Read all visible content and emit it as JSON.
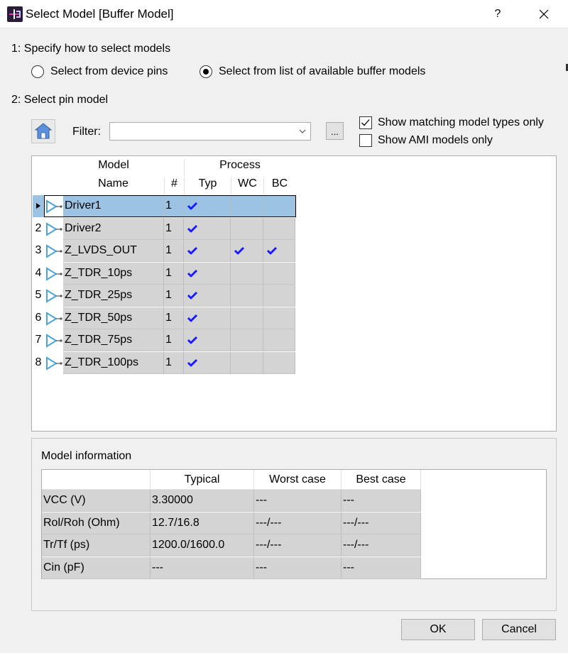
{
  "window": {
    "title": "Select Model [Buffer Model]",
    "help_label": "?"
  },
  "section1": {
    "label": "1: Specify how to select models",
    "option_device_pins": "Select from device pins",
    "option_buffer_list": "Select from list of available buffer models",
    "selected": "buffer_list"
  },
  "section2": {
    "label": "2: Select pin model",
    "filter_label": "Filter:",
    "filter_value": "",
    "browse_label": "...",
    "show_matching_label": "Show matching model types only",
    "show_matching_checked": true,
    "show_ami_label": "Show AMI models only",
    "show_ami_checked": false
  },
  "grid": {
    "group_headers": {
      "model": "Model",
      "process": "Process"
    },
    "columns": {
      "name": "Name",
      "count": "#",
      "typ": "Typ",
      "wc": "WC",
      "bc": "BC"
    },
    "rows": [
      {
        "num": "",
        "name": "Driver1",
        "count": "1",
        "typ": true,
        "wc": false,
        "bc": false,
        "selected": true
      },
      {
        "num": "2",
        "name": "Driver2",
        "count": "1",
        "typ": true,
        "wc": false,
        "bc": false
      },
      {
        "num": "3",
        "name": "Z_LVDS_OUT",
        "count": "1",
        "typ": true,
        "wc": true,
        "bc": true
      },
      {
        "num": "4",
        "name": "Z_TDR_10ps",
        "count": "1",
        "typ": true,
        "wc": false,
        "bc": false
      },
      {
        "num": "5",
        "name": "Z_TDR_25ps",
        "count": "1",
        "typ": true,
        "wc": false,
        "bc": false
      },
      {
        "num": "6",
        "name": "Z_TDR_50ps",
        "count": "1",
        "typ": true,
        "wc": false,
        "bc": false
      },
      {
        "num": "7",
        "name": "Z_TDR_75ps",
        "count": "1",
        "typ": true,
        "wc": false,
        "bc": false
      },
      {
        "num": "8",
        "name": "Z_TDR_100ps",
        "count": "1",
        "typ": true,
        "wc": false,
        "bc": false
      }
    ]
  },
  "model_info": {
    "title": "Model information",
    "columns": [
      "",
      "Typical",
      "Worst case",
      "Best case"
    ],
    "rows": [
      [
        "VCC (V)",
        "3.30000",
        "---",
        "---"
      ],
      [
        "Rol/Roh (Ohm)",
        "12.7/16.8",
        "---/---",
        "---/---"
      ],
      [
        "Tr/Tf (ps)",
        "1200.0/1600.0",
        "---/---",
        "---/---"
      ],
      [
        "Cin (pF)",
        "---",
        "---",
        "---"
      ]
    ]
  },
  "buttons": {
    "ok": "OK",
    "cancel": "Cancel"
  },
  "colors": {
    "selection": "#9cc2e4",
    "tick": "#1a1aff",
    "driver_icon": "#4aa3df",
    "cell_bg": "#d4d4d4"
  }
}
